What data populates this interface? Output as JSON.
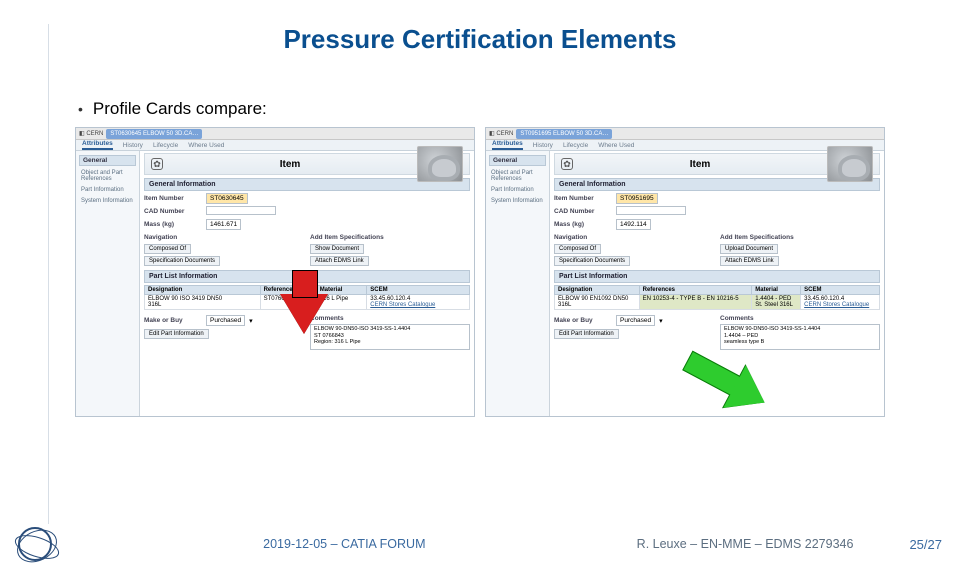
{
  "title": "Pressure Certification Elements",
  "bullet": "Profile Cards compare:",
  "footer": {
    "center": "2019-12-05 – CATIA FORUM",
    "right": "R. Leuxe – EN-MME – EDMS 2279346",
    "page": "25/27"
  },
  "item_label": "Item",
  "sidebar": {
    "group": "General",
    "items": [
      "Object and Part References",
      "Part Information",
      "System Information"
    ]
  },
  "tabs": {
    "active": "Attributes",
    "t2": "History",
    "t3": "Lifecycle",
    "t4": "Where Used"
  },
  "sections": {
    "general": "General Information",
    "partlist": "Part List Information"
  },
  "fields": {
    "item_number": "Item Number",
    "cad_number": "CAD Number",
    "mass": "Mass (kg)",
    "navigation": "Navigation",
    "additem": "Add Item Specifications",
    "designation": "Designation",
    "references": "References",
    "material": "Material",
    "scem": "SCEM",
    "makeorbuy": "Make or Buy",
    "comments": "Comments"
  },
  "buttons": {
    "composed": "Composed Of",
    "specdocs": "Specification Documents",
    "upload": "Upload Document",
    "attach": "Attach EDMS Link",
    "show": "Show Document",
    "editpart": "Edit Part Information"
  },
  "left": {
    "tab_chip": "ST0630645 ELBOW 50 3D.CA…",
    "item_number": "ST0630645",
    "cad_number": "",
    "mass": "1461.671",
    "designation_l1": "ELBOW 90 ISO 3419 DN50",
    "designation_l2": "316L",
    "references": "ST0766843",
    "material": "316 L Pipe",
    "scem": "33.45.60.120.4",
    "scem_link": "CERN Stores Catalogue",
    "makeorbuy": "Purchased",
    "comments_l1": "ELBOW 90-DN50-ISO 3419-SS-1.4404",
    "comments_l2": "ST 0766843",
    "comments_l3": "Region: 316 L Pipe"
  },
  "right": {
    "tab_chip": "ST0951695 ELBOW 50 3D.CA…",
    "item_number": "ST0951695",
    "cad_number": "",
    "mass": "1492.114",
    "designation_l1": "ELBOW 90 EN1092 DN50",
    "designation_l2": "316L",
    "references": "EN 10253-4 - TYPE B - EN 10216-5",
    "material": "1.4404 - PED",
    "scem": "33.45.60.120.4",
    "scem_link": "CERN Stores Catalogue",
    "comments_l1": "ELBOW 90-DN50-ISO 3419-SS-1.4404",
    "comments_l2": "1.4404 – PED",
    "comments_l3": "seamless type B",
    "makeorbuy": "Purchased",
    "material_sub": "St. Steel 316L"
  }
}
